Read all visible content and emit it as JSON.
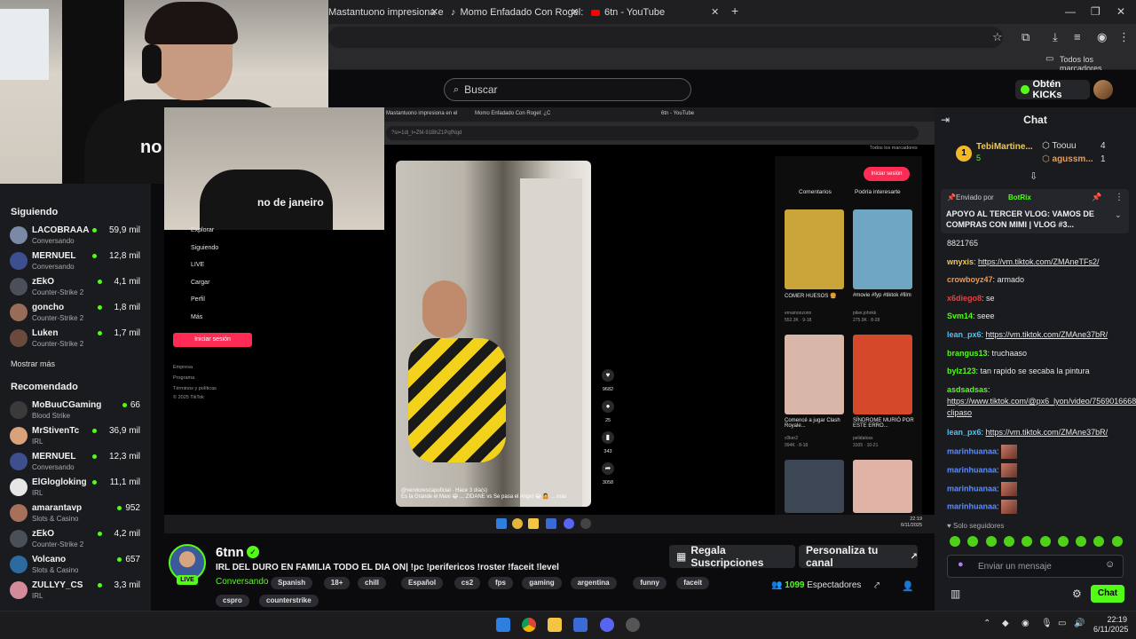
{
  "browser": {
    "tabs": [
      {
        "label": "Mastantuono impresiona en el"
      },
      {
        "label": "Momo Enfadado Con Rogel: ¿C"
      },
      {
        "label": "6tn - YouTube"
      }
    ],
    "bookmarks_label": "Todos los marcadores"
  },
  "kick": {
    "search_placeholder": "Buscar",
    "kicks_button": "Obtén KICKs"
  },
  "webcam": {
    "shirt_text": "no de janeiro"
  },
  "sidebar": {
    "following_heading": "Siguiendo",
    "following": [
      {
        "name": "LACOBRAAA",
        "category": "Conversando",
        "viewers": "59,9 mil",
        "color": "#7a8aa6"
      },
      {
        "name": "MERNUEL",
        "category": "Conversando",
        "viewers": "12,8 mil",
        "color": "#3e4f8f"
      },
      {
        "name": "zEkO",
        "category": "Counter-Strike 2",
        "viewers": "4,1 mil",
        "color": "#4a4f5a"
      },
      {
        "name": "goncho",
        "category": "Counter-Strike 2",
        "viewers": "1,8 mil",
        "color": "#9b6b5a"
      },
      {
        "name": "Luken",
        "category": "Counter-Strike 2",
        "viewers": "1,7 mil",
        "color": "#6a4a3a"
      }
    ],
    "show_more": "Mostrar más",
    "recommended_heading": "Recomendado",
    "recommended": [
      {
        "name": "MoBuuCGaming",
        "category": "Blood Strike",
        "viewers": "66",
        "color": "#3a3a3a"
      },
      {
        "name": "MrStivenTc",
        "category": "IRL",
        "viewers": "36,9 mil",
        "color": "#d9a27a"
      },
      {
        "name": "MERNUEL",
        "category": "Conversando",
        "viewers": "12,3 mil",
        "color": "#3e4f8f"
      },
      {
        "name": "ElGlogloking",
        "category": "IRL",
        "viewers": "11,1 mil",
        "color": "#e6e6e6"
      },
      {
        "name": "amarantavp",
        "category": "Slots & Casino",
        "viewers": "952",
        "color": "#a7705a"
      },
      {
        "name": "zEkO",
        "category": "Counter-Strike 2",
        "viewers": "4,2 mil",
        "color": "#4a4f5a"
      },
      {
        "name": "Volcano",
        "category": "Slots & Casino",
        "viewers": "657",
        "color": "#2c6aa0"
      },
      {
        "name": "ZULLYY_CS",
        "category": "IRL",
        "viewers": "3,3 mil",
        "color": "#d58a9a"
      }
    ]
  },
  "video": {
    "tabs": [
      "Mastantuono impresiona en el",
      "Momo Enfadado Con Rogel: ¿C",
      "6tn - YouTube"
    ],
    "url": "?si=1di_t=ZM-91BhZ1PqfNqd",
    "bookmarks": "Todos los marcadores",
    "shirt_text": "no de janeiro",
    "menu": [
      "Explorar",
      "Siguiendo",
      "LIVE",
      "Cargar",
      "Perfil",
      "Más"
    ],
    "login": "Iniciar sesión",
    "footer": [
      "Empresa",
      "Programa",
      "Términos y políticas",
      "© 2025 TikTok"
    ],
    "caption_user": "@vendorescapoficial · Hace 3 día(s)",
    "caption_text": "Es la Grande el Maxi 😂 ... ZIDANE vs Se pasa el Angel 😂 🤷 ... más",
    "rail": [
      "9682",
      "25",
      "343",
      "3058"
    ],
    "login2": "Iniciar sesión",
    "tab_comments": "Comentarios",
    "tab_interest": "Podría interesarte",
    "thumbs": [
      {
        "title": "COMER HUESOS 🍔",
        "user": "emamonzonn",
        "stats": "552.3K · 9-18",
        "color": "#c9a53a"
      },
      {
        "title": "#movie #fyp #tiktok #film",
        "user": "piker.johnkk",
        "stats": "275.9K · 8-28",
        "color": "#6fa6c4"
      },
      {
        "title": "Comencé a jugar Clash Royale...",
        "user": "c0ker2",
        "stats": "994K · 8-18",
        "color": "#d8b7a8"
      },
      {
        "title": "SÍNDROME MURIÓ POR ESTE ERRO...",
        "user": "pelidatoss",
        "stats": "3105 · 10-21",
        "color": "#d6482a"
      },
      {
        "title": "",
        "user": "",
        "stats": "",
        "color": "#3c4654"
      },
      {
        "title": "",
        "user": "",
        "stats": "",
        "color": "#e0b3a6"
      }
    ],
    "clock_time": "22:19",
    "clock_date": "6/11/2025"
  },
  "stream": {
    "name": "6tnn",
    "live": "LIVE",
    "title": "IRL DEL DURO EN FAMILIA TODO EL DIA ON| !pc !perifericos !roster !faceit !level",
    "category": "Conversando",
    "tags": [
      "Spanish",
      "18+",
      "chill",
      "Español",
      "cs2",
      "fps",
      "gaming",
      "argentina",
      "funny",
      "faceit",
      "cspro",
      "counterstrike"
    ],
    "subs_button": "Regala Suscripciones",
    "custom_button": "Personaliza tu canal",
    "viewers": "1099",
    "viewers_label": "Espectadores"
  },
  "chat": {
    "title": "Chat",
    "top1_name": "TebiMartine...",
    "top1_value": "5",
    "top2_name": "Toouu",
    "top2_value": "4",
    "top3_name": "agussm...",
    "top3_value": "1",
    "pinned_by_label": "Enviado por",
    "pinned_by": "BotRix",
    "pinned_text": "APOYO AL TERCER VLOG: VAMOS DE COMPRAS CON MIMI | VLOG #3...",
    "messages": [
      {
        "user": "",
        "text": "8821765",
        "color": "#e6e6e6",
        "link": false
      },
      {
        "user": "wnyxis",
        "text": "https://vm.tiktok.com/ZMAneTFs2/",
        "color": "#f2c94c",
        "link": true
      },
      {
        "user": "crowboyz47",
        "text": "armado",
        "color": "#f29a4c",
        "link": false
      },
      {
        "user": "x6diego8",
        "text": "se",
        "color": "#e04545",
        "link": false
      },
      {
        "user": "Svm14",
        "text": "seee",
        "color": "#53fc18",
        "link": false
      },
      {
        "user": "lean_px6",
        "text": "https://vm.tiktok.com/ZMAne37bR/",
        "color": "#4cc3f2",
        "link": true
      },
      {
        "user": "brangus13",
        "text": "truchaaso",
        "color": "#53fc18",
        "link": false
      },
      {
        "user": "bylz123",
        "text": "tan rapido se secaba la pintura",
        "color": "#53fc18",
        "link": false
      },
      {
        "user": "asdsadsas",
        "text": "https://www.tiktok.com/@px6_lyon/video/7569016668659770120 clipaso",
        "color": "#53fc18",
        "link": true
      },
      {
        "user": "lean_px6",
        "text": "https://vm.tiktok.com/ZMAne37bR/",
        "color": "#4cc3f2",
        "link": true
      },
      {
        "user": "marinhuanaa",
        "text": "",
        "color": "#5d8cff",
        "link": false
      },
      {
        "user": "marinhuanaa",
        "text": "",
        "color": "#5d8cff",
        "link": false
      },
      {
        "user": "marinhuanaa",
        "text": "",
        "color": "#5d8cff",
        "link": false
      },
      {
        "user": "marinhuanaa",
        "text": "",
        "color": "#5d8cff",
        "link": false
      }
    ],
    "followers_only": "Solo seguidores",
    "input_placeholder": "Enviar un mensaje",
    "send_button": "Chat"
  },
  "taskbar": {
    "time": "22:19",
    "date": "6/11/2025"
  }
}
